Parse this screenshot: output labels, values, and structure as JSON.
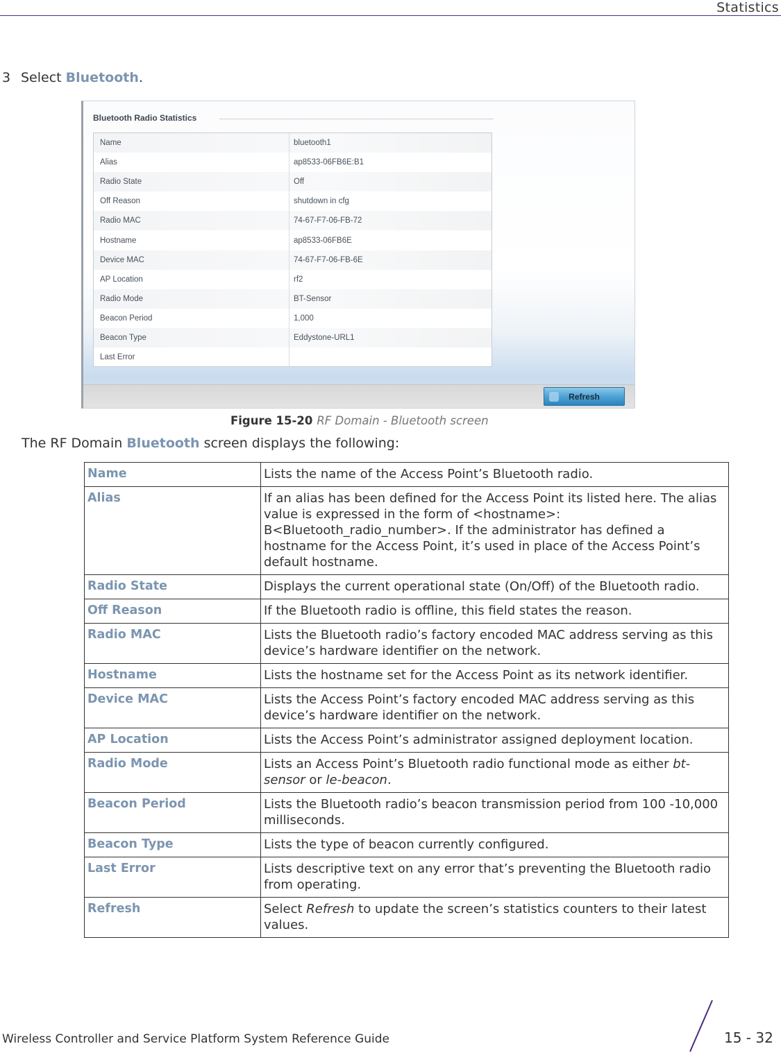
{
  "header": {
    "section": "Statistics"
  },
  "step": {
    "number": "3",
    "prefix": "Select ",
    "target": "Bluetooth",
    "suffix": "."
  },
  "screenshot": {
    "panel_title": "Bluetooth Radio Statistics",
    "rows": [
      {
        "key": "Name",
        "value": "bluetooth1"
      },
      {
        "key": "Alias",
        "value": "ap8533-06FB6E:B1"
      },
      {
        "key": "Radio State",
        "value": "Off"
      },
      {
        "key": "Off Reason",
        "value": "shutdown in cfg"
      },
      {
        "key": "Radio MAC",
        "value": "74-67-F7-06-FB-72"
      },
      {
        "key": "Hostname",
        "value": "ap8533-06FB6E"
      },
      {
        "key": "Device MAC",
        "value": "74-67-F7-06-FB-6E"
      },
      {
        "key": "AP Location",
        "value": "rf2"
      },
      {
        "key": "Radio Mode",
        "value": "BT-Sensor"
      },
      {
        "key": "Beacon Period",
        "value": "1,000"
      },
      {
        "key": "Beacon Type",
        "value": "Eddystone-URL1"
      },
      {
        "key": "Last Error",
        "value": ""
      }
    ],
    "refresh_label": "Refresh",
    "refresh_icon": "refresh-icon"
  },
  "caption": {
    "label": "Figure 15-20",
    "text": "RF Domain - Bluetooth screen"
  },
  "intro": {
    "prefix": "The RF Domain ",
    "target": "Bluetooth",
    "suffix": " screen displays the following:"
  },
  "table": [
    {
      "term": "Name",
      "def": "Lists the name of the Access Point’s Bluetooth radio."
    },
    {
      "term": "Alias",
      "def": "If an alias has been defined for the Access Point its listed here. The alias value is expressed in the form of <hostname>: B<Bluetooth_radio_number>. If the administrator has defined a hostname for the Access Point, it’s used in place of the Access Point’s default hostname."
    },
    {
      "term": "Radio State",
      "def": "Displays the current operational state (On/Off) of the Bluetooth radio."
    },
    {
      "term": "Off Reason",
      "def": "If the Bluetooth radio is offline, this field states the reason."
    },
    {
      "term": "Radio MAC",
      "def": "Lists the Bluetooth radio’s factory encoded MAC address serving as this device’s hardware identifier on the network."
    },
    {
      "term": "Hostname",
      "def": "Lists the hostname set for the Access Point as its network identifier."
    },
    {
      "term": "Device MAC",
      "def": "Lists the Access Point’s factory encoded MAC address serving as this device’s hardware identifier on the network."
    },
    {
      "term": "AP Location",
      "def": "Lists the Access Point’s administrator assigned deployment location."
    },
    {
      "term": "Radio Mode",
      "def_parts": [
        "Lists an Access Point’s Bluetooth radio functional mode as either ",
        "bt-sensor",
        " or ",
        "le-beacon",
        "."
      ]
    },
    {
      "term": "Beacon Period",
      "def": "Lists the Bluetooth radio’s beacon transmission period from 100 -10,000 milliseconds."
    },
    {
      "term": "Beacon Type",
      "def": "Lists the type of beacon currently configured."
    },
    {
      "term": "Last Error",
      "def": "Lists descriptive text on any error that’s preventing the Bluetooth radio from operating."
    },
    {
      "term": "Refresh",
      "def_parts": [
        "Select ",
        "Refresh",
        " to update the screen’s statistics counters to their latest values."
      ]
    }
  ],
  "footer": {
    "guide_title": "Wireless Controller and Service Platform System Reference Guide",
    "page": "15 - 32"
  },
  "colors": {
    "accent": "#7b95b0",
    "rule": "#4b2a84"
  }
}
